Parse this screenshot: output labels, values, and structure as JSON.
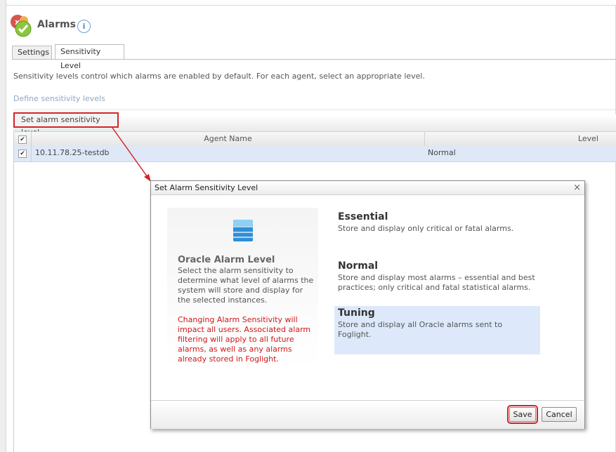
{
  "header": {
    "title": "Alarms",
    "info_icon": "i"
  },
  "tabs": [
    {
      "label": "Settings"
    },
    {
      "label": "Sensitivity Level"
    }
  ],
  "description": "Sensitivity levels control which alarms are enabled by default. For each agent, select an appropriate level.",
  "define_link": "Define sensitivity levels",
  "toolbar": {
    "set_button": "Set alarm sensitivity level"
  },
  "grid": {
    "columns": [
      "Agent Name",
      "Level"
    ],
    "rows": [
      {
        "checked": true,
        "agent": "10.11.78.25-testdb",
        "level": "Normal"
      }
    ]
  },
  "dialog": {
    "title": "Set Alarm Sensitivity Level",
    "close": "×",
    "info": {
      "title": "Oracle Alarm Level",
      "description": "Select the alarm sensitivity to determine what level of alarms the system will store and display for the selected instances.",
      "warning": "Changing Alarm Sensitivity will impact all users. Associated alarm filtering will apply to all future alarms, as well as any alarms already stored in Foglight."
    },
    "options": [
      {
        "title": "Essential",
        "description": "Store and display only critical or fatal alarms."
      },
      {
        "title": "Normal",
        "description": "Store and display most alarms – essential and best practices; only critical and fatal statistical alarms."
      },
      {
        "title": "Tuning",
        "description": "Store and display all Oracle alarms sent to Foglight."
      }
    ],
    "selected_option": "Tuning",
    "buttons": {
      "save": "Save",
      "cancel": "Cancel"
    }
  },
  "colors": {
    "highlight_red": "#d0262a",
    "selected_blue": "#dde9fb",
    "warning_red": "#d01818"
  }
}
